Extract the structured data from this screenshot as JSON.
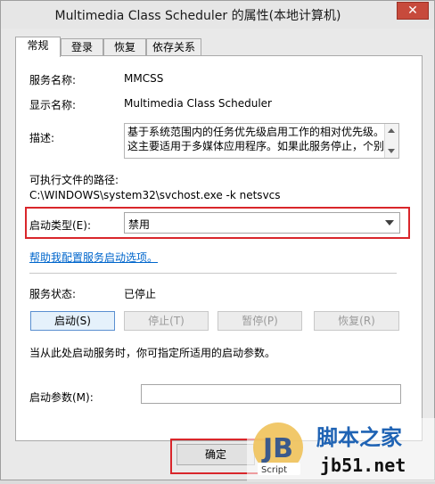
{
  "window": {
    "title": "Multimedia Class Scheduler 的属性(本地计算机)",
    "close_label": "✕"
  },
  "tabs": [
    {
      "label": "常规",
      "active": true
    },
    {
      "label": "登录",
      "active": false
    },
    {
      "label": "恢复",
      "active": false
    },
    {
      "label": "依存关系",
      "active": false
    }
  ],
  "general": {
    "service_name_label": "服务名称:",
    "service_name": "MMCSS",
    "display_name_label": "显示名称:",
    "display_name": "Multimedia Class Scheduler",
    "description_label": "描述:",
    "description": "基于系统范围内的任务优先级启用工作的相对优先级。这主要适用于多媒体应用程序。如果此服务停止，个别",
    "exe_path_label": "可执行文件的路径:",
    "exe_path": "C:\\WINDOWS\\system32\\svchost.exe -k netsvcs",
    "startup_type_label": "启动类型(E):",
    "startup_type": "禁用",
    "help_link": "帮助我配置服务启动选项。",
    "status_label": "服务状态:",
    "status": "已停止",
    "buttons": {
      "start": "启动(S)",
      "stop": "停止(T)",
      "pause": "暂停(P)",
      "resume": "恢复(R)"
    },
    "start_hint": "当从此处启动服务时，你可指定所适用的启动参数。",
    "start_params_label": "启动参数(M):",
    "start_params_value": ""
  },
  "footer": {
    "ok": "确定"
  },
  "watermark": {
    "logo": "JB",
    "script_tag": "Script",
    "site_cn": "脚本之家",
    "site_url": "jb51.net"
  },
  "colors": {
    "highlight_frame": "#d9262b",
    "link": "#0066cc"
  }
}
